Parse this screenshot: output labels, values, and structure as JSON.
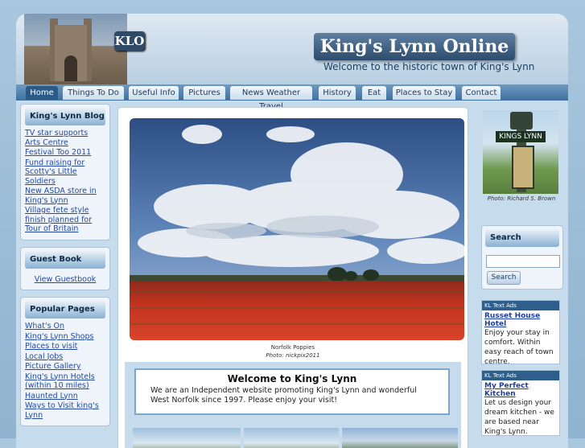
{
  "header": {
    "logo_badge": "KLO",
    "site_title": "King's Lynn Online",
    "tagline": "Welcome to the historic town of King's Lynn"
  },
  "nav": {
    "tabs": [
      {
        "label": "Home",
        "active": true
      },
      {
        "label": "Things To Do"
      },
      {
        "label": "Useful Info"
      },
      {
        "label": "Pictures"
      },
      {
        "label": "News Weather Travel"
      },
      {
        "label": "History"
      },
      {
        "label": "Eat"
      },
      {
        "label": "Places to Stay"
      },
      {
        "label": "Contact"
      }
    ]
  },
  "blog": {
    "title": "King's Lynn Blog",
    "items": [
      "TV star supports Arts Centre",
      "Festival Too 2011",
      "Fund raising for Scotty's Little Soldiers",
      "New ASDA store in King's Lynn",
      "Village fete style finish planned for Tour of Britain"
    ]
  },
  "guestbook": {
    "title": "Guest Book",
    "link": "View Guestbook"
  },
  "popular": {
    "title": "Popular Pages",
    "items": [
      "What's On",
      "King's Lynn Shops",
      "Places to visit",
      "Local Jobs",
      "Picture Gallery",
      "King's Lynn Hotels (within 10 miles)",
      "Haunted Lynn",
      "Ways to Visit king's Lynn"
    ]
  },
  "hero": {
    "caption": "Norfolk Poppies",
    "credit": "Photo: nickpix2011"
  },
  "welcome": {
    "title": "Welcome to King's Lynn",
    "text": "We are an Independent website promoting King's Lynn and wonderful West Norfolk since 1997. Please enjoy your visit!"
  },
  "right": {
    "sign_text": "KINGS LYNN",
    "photo_credit": "Photo: Richard S. Brown",
    "search": {
      "title": "Search",
      "placeholder": "",
      "button": "Search"
    },
    "ads": [
      {
        "header": "KL Text Ads",
        "title": "Russet House Hotel",
        "text": "Enjoy your stay in comfort. Within easy reach of town centre."
      },
      {
        "header": "KL Text Ads",
        "title": "My Perfect Kitchen",
        "text": "Let us design your dream kitchen - we are based near King's Lynn."
      }
    ]
  },
  "colors": {
    "nav_bar": "#3f709e",
    "link": "#2349a3",
    "title_bg": "#2d4c6d",
    "poppy_red": "#c2331f"
  }
}
